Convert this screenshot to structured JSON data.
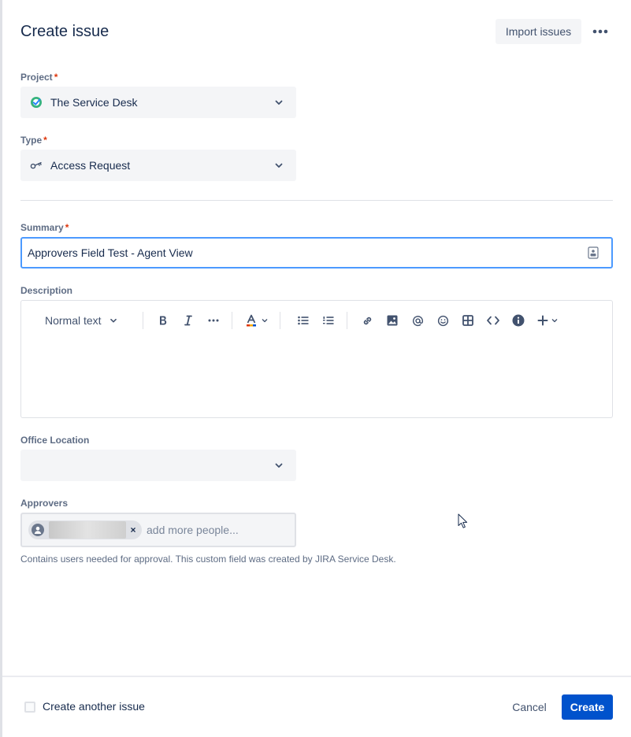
{
  "header": {
    "title": "Create issue",
    "import_label": "Import issues"
  },
  "fields": {
    "project": {
      "label": "Project",
      "required": "*",
      "value": "The Service Desk",
      "icon": "service-desk-icon"
    },
    "type": {
      "label": "Type",
      "required": "*",
      "value": "Access Request",
      "icon": "key-icon"
    },
    "summary": {
      "label": "Summary",
      "required": "*",
      "value": "Approvers Field Test - Agent View"
    },
    "description": {
      "label": "Description",
      "toolbar": {
        "text_style": "Normal text"
      }
    },
    "office_location": {
      "label": "Office Location",
      "value": ""
    },
    "approvers": {
      "label": "Approvers",
      "placeholder": "add more people...",
      "remove_glyph": "×",
      "helper": "Contains users needed for approval. This custom field was created by JIRA Service Desk."
    }
  },
  "footer": {
    "create_another_label": "Create another issue",
    "cancel_label": "Cancel",
    "create_label": "Create"
  },
  "colors": {
    "primary": "#0052cc",
    "focus_border": "#4c9aff",
    "required": "#de350b",
    "field_bg": "#f4f5f7"
  }
}
